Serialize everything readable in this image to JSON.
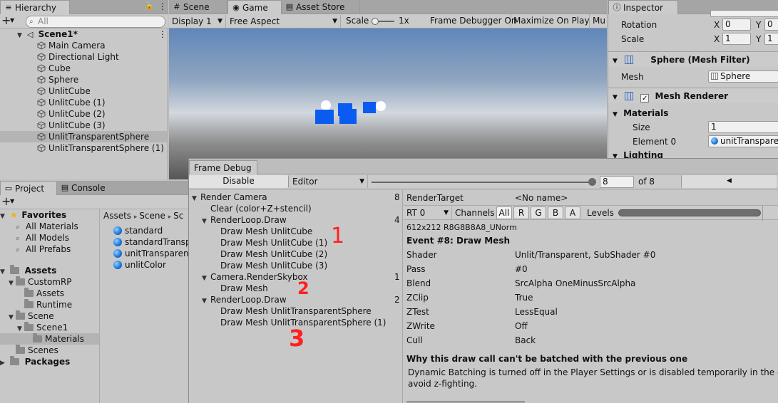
{
  "hierarchy": {
    "tab": "Hierarchy",
    "add": "+",
    "search_placeholder": "All",
    "scene": "Scene1*",
    "items": [
      "Main Camera",
      "Directional Light",
      "Cube",
      "Sphere",
      "UnlitCube",
      "UnlitCube (1)",
      "UnlitCube (2)",
      "UnlitCube (3)",
      "UnlitTransparentSphere",
      "UnlitTransparentSphere (1)"
    ],
    "selected_index": 8
  },
  "center_tabs": [
    "Scene",
    "Game",
    "Asset Store"
  ],
  "game_toolbar": {
    "display": "Display 1",
    "aspect": "Free Aspect",
    "scale_label": "Scale",
    "scale_value": "1x",
    "frame_debugger": "Frame Debugger On",
    "maximize": "Maximize On Play",
    "mute": "Mu"
  },
  "inspector": {
    "tab": "Inspector",
    "rotation_label": "Rotation",
    "rotation_x": "0",
    "rotation_y": "0",
    "scale_label": "Scale",
    "scale_x": "1",
    "scale_y": "1",
    "axis_x": "X",
    "axis_y": "Y",
    "mesh_filter_title": "Sphere (Mesh Filter)",
    "mesh_label": "Mesh",
    "mesh_value": "Sphere",
    "mesh_renderer_title": "Mesh Renderer",
    "materials_label": "Materials",
    "size_label": "Size",
    "size_value": "1",
    "element0_label": "Element 0",
    "element0_value": "unitTransparen",
    "lighting_label": "Lighting"
  },
  "project": {
    "tabs": [
      "Project",
      "Console"
    ],
    "add": "+",
    "favorites_label": "Favorites",
    "favorites": [
      "All Materials",
      "All Models",
      "All Prefabs"
    ],
    "assets_label": "Assets",
    "tree": [
      "CustomRP",
      "Assets",
      "Runtime",
      "Scene",
      "Scene1",
      "Materials",
      "Scenes"
    ],
    "packages_label": "Packages",
    "breadcrumb": [
      "Assets",
      "Scene",
      "Sc"
    ],
    "files": [
      "standard",
      "standardTranspa",
      "unitTransparent",
      "unlitColor"
    ]
  },
  "frame_debug": {
    "tab": "Frame Debug",
    "disable": "Disable",
    "target": "Editor",
    "frame_value": "8",
    "of_label": "of 8",
    "frame_fraction": 1.0,
    "tree": [
      {
        "label": "Render Camera",
        "count": "8",
        "depth": 0,
        "arrow": true
      },
      {
        "label": "Clear (color+Z+stencil)",
        "count": "",
        "depth": 1,
        "arrow": false
      },
      {
        "label": "RenderLoop.Draw",
        "count": "4",
        "depth": 1,
        "arrow": true
      },
      {
        "label": "Draw Mesh UnlitCube",
        "count": "",
        "depth": 2,
        "arrow": false
      },
      {
        "label": "Draw Mesh UnlitCube (1)",
        "count": "",
        "depth": 2,
        "arrow": false
      },
      {
        "label": "Draw Mesh UnlitCube (2)",
        "count": "",
        "depth": 2,
        "arrow": false
      },
      {
        "label": "Draw Mesh UnlitCube (3)",
        "count": "",
        "depth": 2,
        "arrow": false
      },
      {
        "label": "Camera.RenderSkybox",
        "count": "1",
        "depth": 1,
        "arrow": true
      },
      {
        "label": "Draw Mesh",
        "count": "",
        "depth": 2,
        "arrow": false
      },
      {
        "label": "RenderLoop.Draw",
        "count": "2",
        "depth": 1,
        "arrow": true
      },
      {
        "label": "Draw Mesh UnlitTransparentSphere",
        "count": "",
        "depth": 2,
        "arrow": false
      },
      {
        "label": "Draw Mesh UnlitTransparentSphere (1)",
        "count": "",
        "depth": 2,
        "arrow": false
      }
    ],
    "render_target_label": "RenderTarget",
    "render_target_value": "<No name>",
    "rt_select": "RT 0",
    "channels_label": "Channels",
    "channels": [
      "All",
      "R",
      "G",
      "B",
      "A"
    ],
    "levels_label": "Levels",
    "format": "612x212 R8G8B8A8_UNorm",
    "event": "Event #8: Draw Mesh",
    "props": [
      {
        "k": "Shader",
        "v": "Unlit/Transparent, SubShader #0"
      },
      {
        "k": "Pass",
        "v": "#0"
      },
      {
        "k": "Blend",
        "v": "SrcAlpha OneMinusSrcAlpha"
      },
      {
        "k": "ZClip",
        "v": "True"
      },
      {
        "k": "ZTest",
        "v": "LessEqual"
      },
      {
        "k": "ZWrite",
        "v": "Off"
      },
      {
        "k": "Cull",
        "v": "Back"
      }
    ],
    "why_title": "Why this draw call can't be batched with the previous one",
    "why_text_1": "Dynamic Batching is turned off in the Player Settings or is disabled temporarily in the current c",
    "why_text_2": "avoid z-fighting."
  },
  "annotations": [
    "1",
    "2",
    "3"
  ],
  "colors": {
    "annotation": "#ff2020",
    "mesh_blue": "#0a5cf0"
  }
}
